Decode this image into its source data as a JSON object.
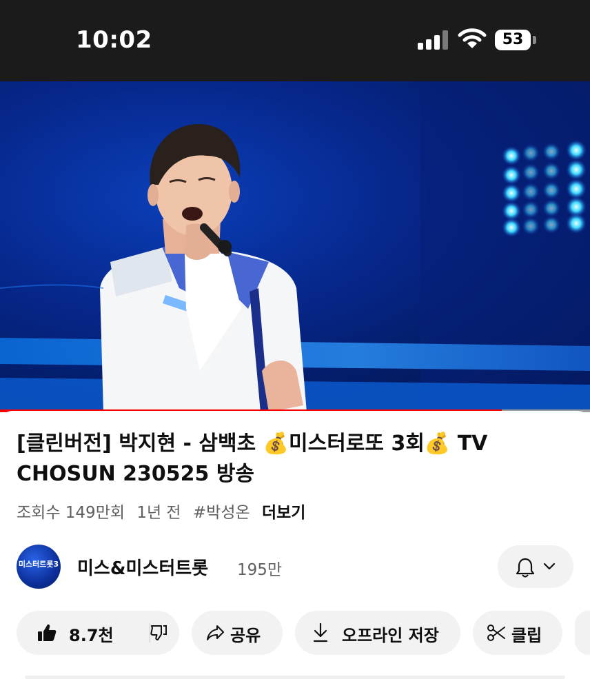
{
  "status_bar": {
    "time": "10:02",
    "battery": "53"
  },
  "video": {
    "progress": 0.85
  },
  "title": "[클린버전] 박지현 - 삼백초 💰미스터로또 3회💰 TV CHOSUN 230525 방송",
  "meta": {
    "views": "조회수 149만회",
    "age": "1년 전",
    "hashtag": "#박성온",
    "more": "더보기"
  },
  "channel": {
    "name": "미스&미스터트롯",
    "subscribers": "195만",
    "avatar_text": "미스터트롯3"
  },
  "actions": {
    "likes": "8.7천",
    "share": "공유",
    "download": "오프라인 저장",
    "clip": "클립"
  }
}
